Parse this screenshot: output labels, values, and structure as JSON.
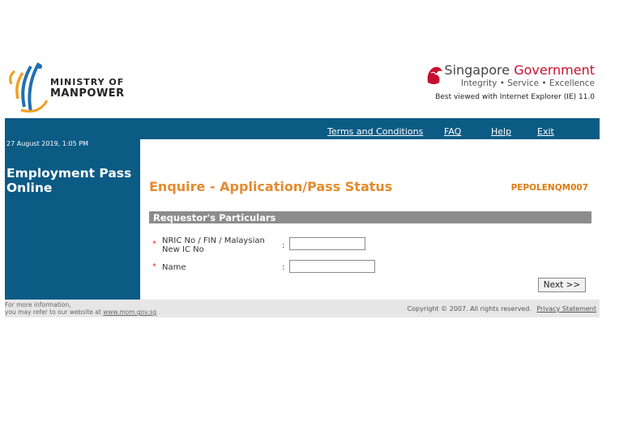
{
  "header": {
    "ministry_line1": "MINISTRY OF",
    "ministry_line2": "MANPOWER",
    "sg_title_1": "Singapore",
    "sg_title_2": "Government",
    "sg_tagline": "Integrity • Service • Excellence",
    "best_viewed": "Best viewed with Internet Explorer (IE) 11.0"
  },
  "nav": {
    "items": [
      "Terms and Conditions",
      "FAQ",
      "Help",
      "Exit"
    ]
  },
  "sidebar": {
    "datetime": "27 August 2019, 1:05 PM",
    "title": "Employment Pass Online"
  },
  "main": {
    "title": "Enquire - Application/Pass Status",
    "code": "PEPOLENQM007",
    "section_title": "Requestor's Particulars",
    "fields": [
      {
        "label": "NRIC No / FIN / Malaysian New IC No",
        "value": "",
        "required_mark": "*"
      },
      {
        "label": "Name",
        "value": "",
        "required_mark": "*"
      }
    ],
    "colon": ":",
    "next_label": "Next >>"
  },
  "footer": {
    "info_line1": "For more information,",
    "info_line2": "you may refer to our website at",
    "website_link": "www.mom.gov.sg",
    "copyright": "Copyright © 2007. All rights reserved.",
    "privacy_link": "Privacy Statement"
  },
  "colors": {
    "nav_blue": "#0b5b85",
    "title_orange": "#e58a2c",
    "section_grey": "#8c8c8c",
    "gov_red": "#c8102e"
  }
}
